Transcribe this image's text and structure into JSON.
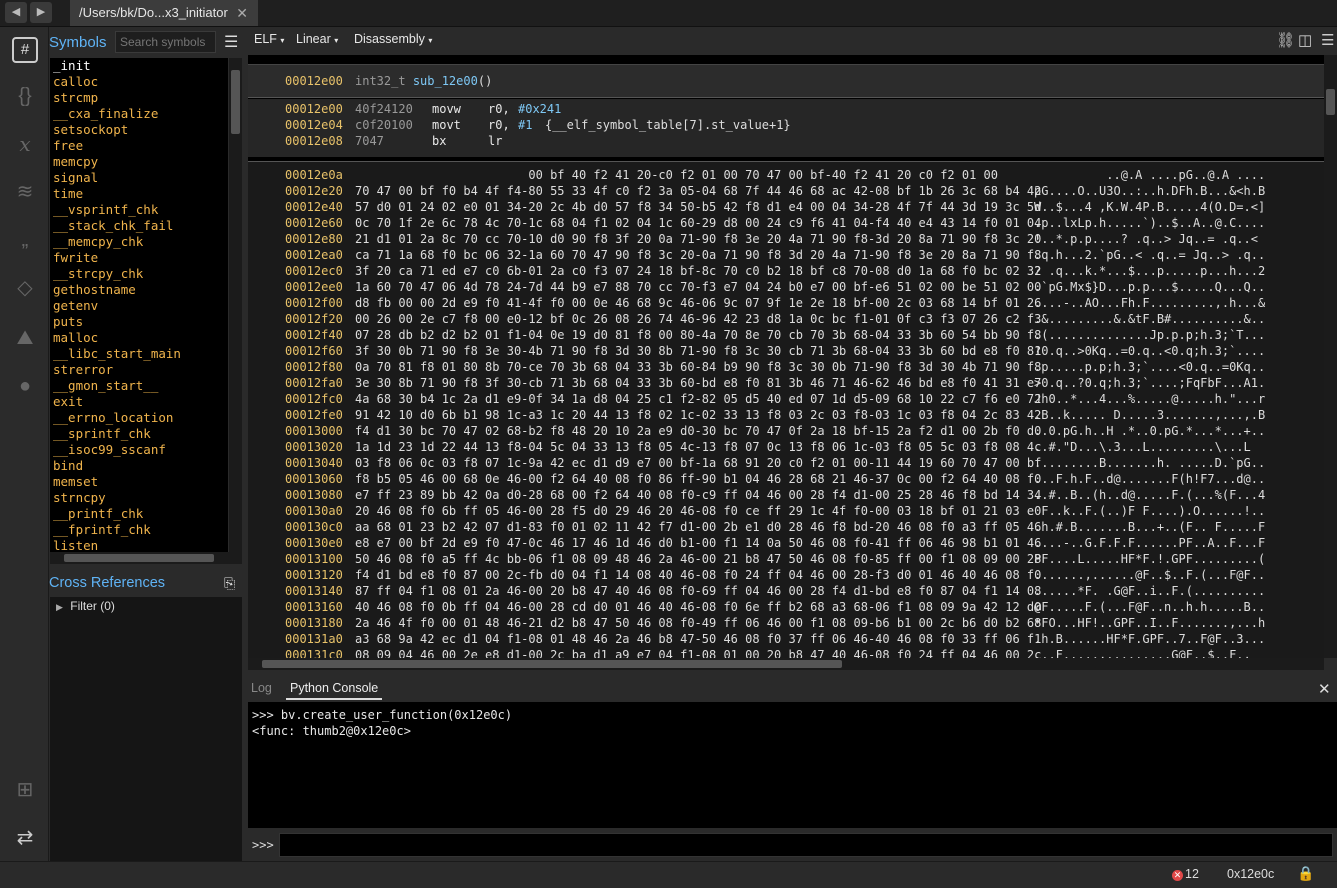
{
  "tab": {
    "title": "/Users/bk/Do...x3_initiator",
    "close": "✕"
  },
  "nav": {
    "back": "◀",
    "forward": "▶"
  },
  "sidebar": {
    "symbols_title": "Symbols",
    "search_placeholder": "Search symbols",
    "menu_icon": "☰",
    "symbols": [
      "_init",
      "calloc",
      "strcmp",
      "__cxa_finalize",
      "setsockopt",
      "free",
      "memcpy",
      "signal",
      "time",
      "__vsprintf_chk",
      "__stack_chk_fail",
      "__memcpy_chk",
      "fwrite",
      "__strcpy_chk",
      "gethostname",
      "getenv",
      "puts",
      "malloc",
      "__libc_start_main",
      "strerror",
      "__gmon_start__",
      "exit",
      "__errno_location",
      "__sprintf_chk",
      "__isoc99_sscanf",
      "bind",
      "memset",
      "strncpy",
      "__printf_chk",
      "__fprintf_chk",
      "listen"
    ],
    "xref_title": "Cross References",
    "filter_label": "Filter (0)"
  },
  "toolbar": {
    "view_type": "ELF",
    "layout": "Linear",
    "mode": "Disassembly"
  },
  "function_header": {
    "address": "00012e00",
    "prototype_type": "int32_t",
    "prototype_name": "sub_12e00",
    "prototype_args": "()"
  },
  "disassembly": [
    {
      "addr": "00012e00",
      "bytes": "40f24120",
      "mnemonic": "movw",
      "op1": "r0,",
      "op2": "#0x241",
      "comment": ""
    },
    {
      "addr": "00012e04",
      "bytes": "c0f20100",
      "mnemonic": "movt",
      "op1": "r0,",
      "op2": "#1",
      "comment": "{__elf_symbol_table[7].st_value+1}"
    },
    {
      "addr": "00012e08",
      "bytes": "7047",
      "mnemonic": "bx",
      "op1": "lr",
      "op2": "",
      "comment": ""
    }
  ],
  "hex_rows": [
    {
      "addr": "00012e0a",
      "bytes": "                        00 bf 40 f2 41 20-c0 f2 01 00 70 47 00 bf-40 f2 41 20 c0 f2 01 00",
      "ascii": "          ..@.A ....pG..@.A ...."
    },
    {
      "addr": "00012e20",
      "bytes": "70 47 00 bf f0 b4 4f f4-80 55 33 4f c0 f2 3a 05-04 68 7f 44 46 68 ac 42-08 bf 1b 26 3c 68 b4 42",
      "ascii": "pG....O..U3O..:..h.DFh.B...&<h.B"
    },
    {
      "addr": "00012e40",
      "bytes": "57 d0 01 24 02 e0 01 34-20 2c 4b d0 57 f8 34 50-b5 42 f8 d1 e4 00 04 34-28 4f 7f 44 3d 19 3c 5d",
      "ascii": "W..$...4 ,K.W.4P.B.....4(O.D=.<]"
    },
    {
      "addr": "00012e60",
      "bytes": "0c 70 1f 2e 6c 78 4c 70-1c 68 04 f1 02 04 1c 60-29 d8 00 24 c9 f6 41 04-f4 40 e4 43 14 f0 01 04",
      "ascii": ".p..lxLp.h.....`)..$..A..@.C...."
    },
    {
      "addr": "00012e80",
      "bytes": "21 d1 01 2a 8c 70 cc 70-10 d0 90 f8 3f 20 0a 71-90 f8 3e 20 4a 71 90 f8-3d 20 8a 71 90 f8 3c 20",
      "ascii": "!..*.p.p....? .q..> Jq..= .q..< "
    },
    {
      "addr": "00012ea0",
      "bytes": "ca 71 1a 68 f0 bc 06 32-1a 60 70 47 90 f8 3c 20-0a 71 90 f8 3d 20 4a 71-90 f8 3e 20 8a 71 90 f8",
      "ascii": ".q.h...2.`pG..< .q..= Jq..> .q.."
    },
    {
      "addr": "00012ec0",
      "bytes": "3f 20 ca 71 ed e7 c0 6b-01 2a c0 f3 07 24 18 bf-8c 70 c0 b2 18 bf c8 70-08 d0 1a 68 f0 bc 02 32",
      "ascii": "? .q...k.*...$...p.....p...h...2"
    },
    {
      "addr": "00012ee0",
      "bytes": "1a 60 70 47 06 4d 78 24-7d 44 b9 e7 88 70 cc 70-f3 e7 04 24 b0 e7 00 bf-e6 51 02 00 be 51 02 00",
      "ascii": ".`pG.Mx$}D...p.p...$.....Q...Q.."
    },
    {
      "addr": "00012f00",
      "bytes": "d8 fb 00 00 2d e9 f0 41-4f f0 00 0e 46 68 9c 46-06 9c 07 9f 1e 2e 18 bf-00 2c 03 68 14 bf 01 26",
      "ascii": "....-..AO...Fh.F.........,.h...&"
    },
    {
      "addr": "00012f20",
      "bytes": "00 26 00 2e c7 f8 00 e0-12 bf 0c 26 08 26 74 46-96 42 23 d8 1a 0c bc f1-01 0f c3 f3 07 26 c2 f3",
      "ascii": ".&.........&.&tF.B#..........&.."
    },
    {
      "addr": "00012f40",
      "bytes": "07 28 db b2 d2 b2 01 f1-04 0e 19 d0 81 f8 00 80-4a 70 8e 70 cb 70 3b 68-04 33 3b 60 54 bb 90 f8",
      "ascii": ".(..............Jp.p.p;h.3;`T..."
    },
    {
      "addr": "00012f60",
      "bytes": "3f 30 0b 71 90 f8 3e 30-4b 71 90 f8 3d 30 8b 71-90 f8 3c 30 cb 71 3b 68-04 33 3b 60 bd e8 f0 81",
      "ascii": "?0.q..>0Kq..=0.q..<0.q;h.3;`...."
    },
    {
      "addr": "00012f80",
      "bytes": "0a 70 81 f8 01 80 8b 70-ce 70 3b 68 04 33 3b 60-84 b9 90 f8 3c 30 0b 71-90 f8 3d 30 4b 71 90 f8",
      "ascii": ".p.....p.p;h.3;`....<0.q..=0Kq.."
    },
    {
      "addr": "00012fa0",
      "bytes": "3e 30 8b 71 90 f8 3f 30-cb 71 3b 68 04 33 3b 60-bd e8 f0 81 3b 46 71 46-62 46 bd e8 f0 41 31 e7",
      "ascii": ">0.q..?0.q;h.3;`....;FqFbF...A1."
    },
    {
      "addr": "00012fc0",
      "bytes": "4a 68 30 b4 1c 2a d1 e9-0f 34 1a d8 04 25 c1 f2-82 05 d5 40 ed 07 1d d5-09 68 10 22 c7 f6 e0 72",
      "ascii": "Jh0..*...4...%.....@.....h.\"...r"
    },
    {
      "addr": "00012fe0",
      "bytes": "91 42 10 d0 6b b1 98 1c-a3 1c 20 44 13 f8 02 1c-02 33 13 f8 03 2c 03 f8-03 1c 03 f8 04 2c 83 42",
      "ascii": ".B..k..... D.....3.......,...,.B"
    },
    {
      "addr": "00013000",
      "bytes": "f4 d1 30 bc 70 47 02 68-b2 f8 48 20 10 2a e9 d0-30 bc 70 47 0f 2a 18 bf-15 2a f2 d1 00 2b f0 d0",
      "ascii": "..0.pG.h..H .*..0.pG.*...*...+.."
    },
    {
      "addr": "00013020",
      "bytes": "1a 1d 23 1d 22 44 13 f8-04 5c 04 33 13 f8 05 4c-13 f8 07 0c 13 f8 06 1c-03 f8 05 5c 03 f8 08 4c",
      "ascii": "..#.\"D...\\.3...L.........\\...L"
    },
    {
      "addr": "00013040",
      "bytes": "03 f8 06 0c 03 f8 07 1c-9a 42 ec d1 d9 e7 00 bf-1a 68 91 20 c0 f2 01 00-11 44 19 60 70 47 00 bf",
      "ascii": ".........B.......h. .....D.`pG.."
    },
    {
      "addr": "00013060",
      "bytes": "f8 b5 05 46 00 68 0e 46-00 f2 64 40 08 f0 86 ff-90 b1 04 46 28 68 21 46-37 0c 00 f2 64 40 08 f0",
      "ascii": "...F.h.F..d@.......F(h!F7...d@.."
    },
    {
      "addr": "00013080",
      "bytes": "e7 ff 23 89 bb 42 0a d0-28 68 00 f2 64 40 08 f0-c9 ff 04 46 00 28 f4 d1-00 25 28 46 f8 bd 14 34",
      "ascii": "..#..B..(h..d@.....F.(...%(F...4"
    },
    {
      "addr": "000130a0",
      "bytes": "20 46 08 f0 6b ff 05 46-00 28 f5 d0 29 46 20 46-08 f0 ce ff 29 1c 4f f0-00 03 18 bf 01 21 03 e0",
      "ascii": " F..k..F.(..)F F....).O......!.."
    },
    {
      "addr": "000130c0",
      "bytes": "aa 68 01 23 b2 42 07 d1-83 f0 01 02 11 42 f7 d1-00 2b e1 d0 28 46 f8 bd-20 46 08 f0 a3 ff 05 46",
      "ascii": ".h.#.B.......B...+..(F.. F.....F"
    },
    {
      "addr": "000130e0",
      "bytes": "e8 e7 00 bf 2d e9 f0 47-0c 46 17 46 1d 46 d0 b1-00 f1 14 0a 50 46 08 f0-41 ff 06 46 98 b1 01 46",
      "ascii": "....-..G.F.F.F......PF..A..F...F"
    },
    {
      "addr": "00013100",
      "bytes": "50 46 08 f0 a5 ff 4c bb-06 f1 08 09 48 46 2a 46-00 21 b8 47 50 46 08 f0-85 ff 00 f1 08 09 00 28",
      "ascii": "PF....L.....HF*F.!.GPF.........("
    },
    {
      "addr": "00013120",
      "bytes": "f4 d1 bd e8 f0 87 00 2c-fb d0 04 f1 14 08 40 46-08 f0 24 ff 04 46 00 28-f3 d0 01 46 40 46 08 f0",
      "ascii": ".......,......@F..$..F.(...F@F.."
    },
    {
      "addr": "00013140",
      "bytes": "87 ff 04 f1 08 01 2a 46-00 20 b8 47 40 46 08 f0-69 ff 04 46 00 28 f4 d1-bd e8 f0 87 04 f1 14 08",
      "ascii": "......*F. .G@F..i..F.(.........."
    },
    {
      "addr": "00013160",
      "bytes": "40 46 08 f0 0b ff 04 46-00 28 cd d0 01 46 40 46-08 f0 6e ff b2 68 a3 68-06 f1 08 09 9a 42 12 d0",
      "ascii": "@F.....F.(...F@F..n..h.h.....B.."
    },
    {
      "addr": "00013180",
      "bytes": "2a 46 4f f0 00 01 48 46-21 d2 b8 47 50 46 08 f0-49 ff 06 46 00 f1 08 09-b6 b1 00 2c b6 d0 b2 68",
      "ascii": "*FO...HF!..GPF..I..F.......,...h"
    },
    {
      "addr": "000131a0",
      "bytes": "a3 68 9a 42 ec d1 04 f1-08 01 48 46 2a 46 b8 47-50 46 08 f0 37 ff 06 46-40 46 08 f0 33 ff 06 f1",
      "ascii": ".h.B......HF*F.GPF..7..F@F..3..."
    },
    {
      "addr": "000131c0",
      "bytes": "08 09 04 46 00 2e e8 d1-00 2c ba d1 a9 e7 04 f1-08 01 00 20 b8 47 40 46-08 f0 24 ff 04 46 00 2c",
      "ascii": "...F.....,.........G@F..$..F.,"
    }
  ],
  "console": {
    "tab_log": "Log",
    "tab_python": "Python Console",
    "lines": [
      ">>> bv.create_user_function(0x12e0c)",
      "<func: thumb2@0x12e0c>"
    ],
    "prompt": ">>>",
    "close": "✕"
  },
  "status": {
    "errors": "12",
    "address": "0x12e0c"
  },
  "colors": {
    "accent": "#5fb3f5",
    "address": "#e9c36a",
    "symbol": "#f0b44c",
    "mnemonic": "#e8e8e8",
    "register": "#e8e8e8",
    "number": "#7ec8f5"
  }
}
